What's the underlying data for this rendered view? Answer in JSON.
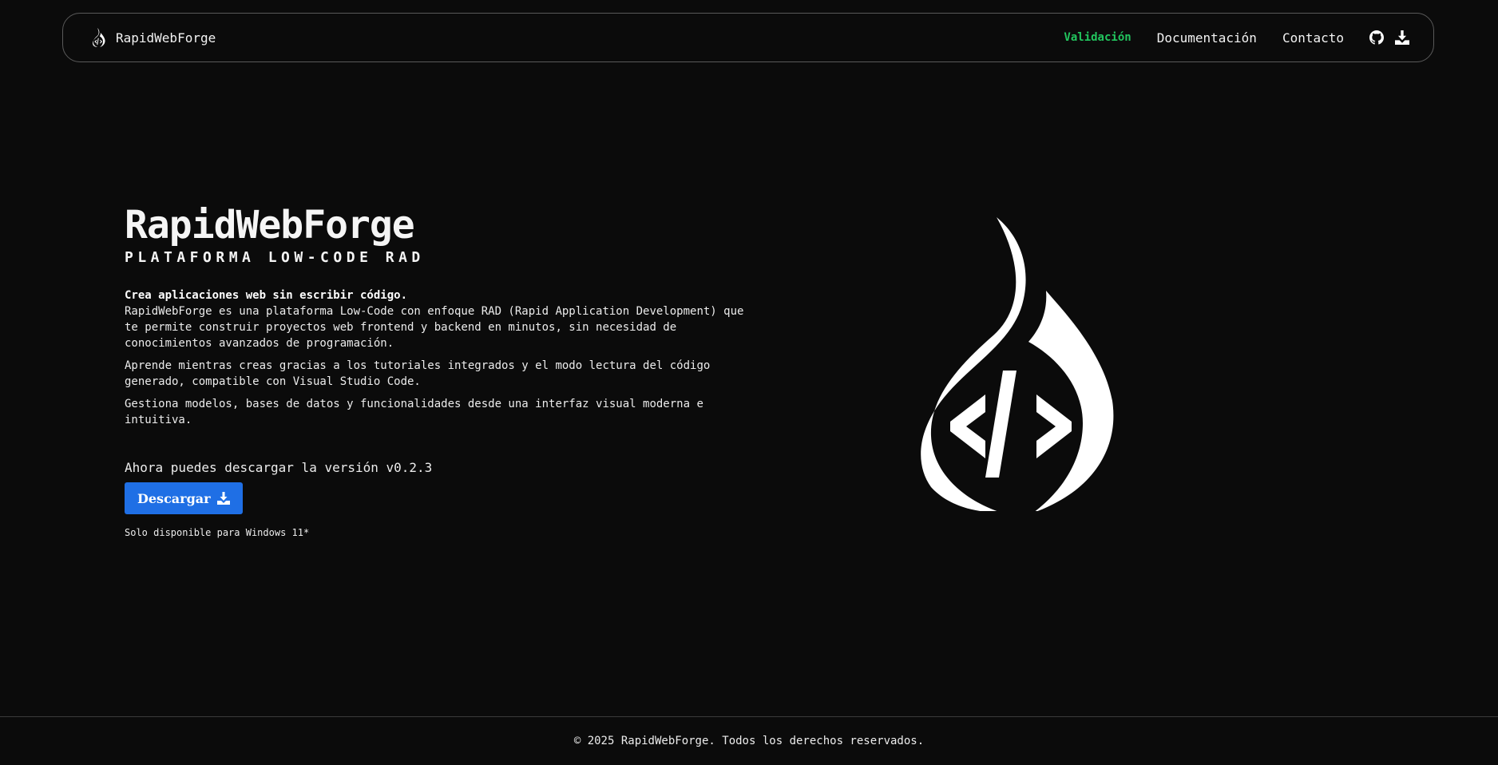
{
  "brand": {
    "name": "RapidWebForge",
    "icon": "flame-code-icon"
  },
  "nav": {
    "links": [
      {
        "label": "Validación",
        "active": true,
        "color": "#22c55e"
      },
      {
        "label": "Documentación",
        "active": false
      },
      {
        "label": "Contacto",
        "active": false
      }
    ],
    "icons": [
      "github-icon",
      "download-icon"
    ]
  },
  "hero": {
    "title": "RapidWebForge",
    "subtitle": "PLATAFORMA LOW-CODE RAD",
    "lead_bold": "Crea aplicaciones web sin escribir código.",
    "paragraphs": [
      "RapidWebForge es una plataforma Low-Code con enfoque RAD (Rapid Application Development) que te permite construir proyectos web frontend y backend en minutos, sin necesidad de conocimientos avanzados de programación.",
      "Aprende mientras creas gracias a los tutoriales integrados y el modo lectura del código generado, compatible con Visual Studio Code.",
      "Gestiona modelos, bases de datos y funcionalidades desde una interfaz visual moderna e intuitiva."
    ],
    "version_text": "Ahora puedes descargar la versión v0.2.3",
    "download_label": "Descargar",
    "note": "Solo disponible para Windows 11*"
  },
  "footer": {
    "text": "© 2025 RapidWebForge. Todos los derechos reservados."
  },
  "colors": {
    "background": "#0b0b0b",
    "accent_green": "#22c55e",
    "button_blue": "#1f6fe5"
  }
}
